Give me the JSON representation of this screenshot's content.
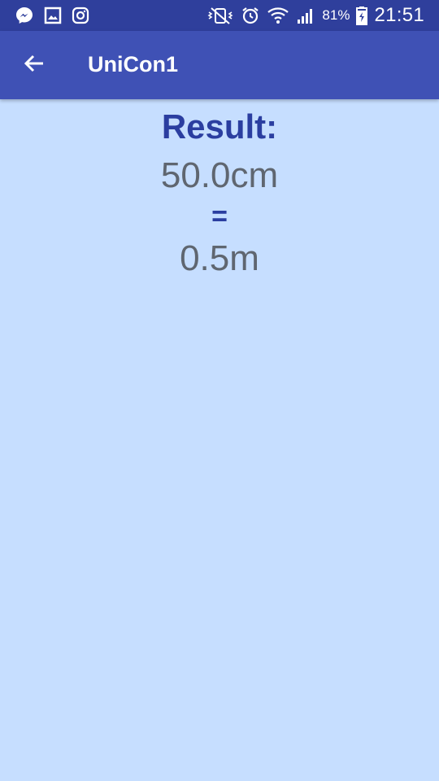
{
  "status_bar": {
    "left_icons": [
      "messenger-icon",
      "gallery-icon",
      "instagram-icon"
    ],
    "right_icons": [
      "vibrate-icon",
      "alarm-icon",
      "wifi-icon",
      "signal-icon",
      "battery-icon"
    ],
    "battery_percent": "81%",
    "time": "21:51"
  },
  "app_bar": {
    "title": "UniCon1",
    "back_icon": "back-arrow-icon"
  },
  "result": {
    "label": "Result:",
    "input_value": "50.0cm",
    "equals": "=",
    "output_value": "0.5m"
  },
  "colors": {
    "status_bar": "#2f3f9c",
    "app_bar": "#3f51b5",
    "background": "#c6deff",
    "accent_text": "#2b3ea0",
    "value_text": "#5f6670"
  }
}
